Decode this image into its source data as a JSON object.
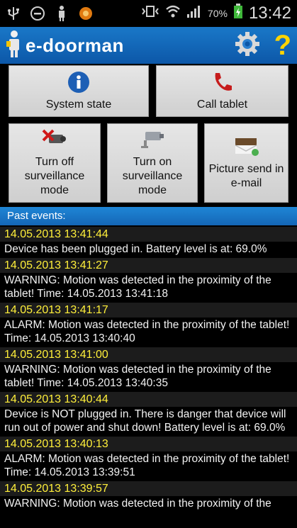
{
  "status_bar": {
    "battery_text": "70%",
    "time": "13:42",
    "icons": [
      "usb-icon",
      "do-not-disturb-icon",
      "doorman-icon",
      "app-badge-icon",
      "vibrate-icon",
      "wifi-icon",
      "signal-icon",
      "battery-icon"
    ]
  },
  "app": {
    "title": "e-doorman"
  },
  "buttons": {
    "system_state": "System state",
    "call_tablet": "Call tablet",
    "turn_off": "Turn off\nsurveillance\nmode",
    "turn_on": "Turn on\nsurveillance\nmode",
    "picture_send": "Picture send in\ne-mail"
  },
  "events_header": "Past events:",
  "events": [
    {
      "time": "14.05.2013 13:41:44",
      "text": "Device has been plugged in. Battery level is at: 69.0%"
    },
    {
      "time": "14.05.2013 13:41:27",
      "text": "WARNING: Motion was detected in the proximity of the tablet! Time: 14.05.2013 13:41:18"
    },
    {
      "time": "14.05.2013 13:41:17",
      "text": "ALARM: Motion was detected in the proximity of the tablet! Time: 14.05.2013 13:40:40"
    },
    {
      "time": "14.05.2013 13:41:00",
      "text": "WARNING: Motion was detected in the proximity of the tablet! Time: 14.05.2013 13:40:35"
    },
    {
      "time": "14.05.2013 13:40:44",
      "text": "Device is NOT plugged in. There is danger that device will run out of power and shut down! Battery level is at: 69.0%"
    },
    {
      "time": "14.05.2013 13:40:13",
      "text": "ALARM: Motion was detected in the proximity of the tablet! Time: 14.05.2013 13:39:51"
    },
    {
      "time": "14.05.2013 13:39:57",
      "text": "WARNING: Motion was detected in the proximity of the"
    }
  ],
  "colors": {
    "appbar": "#0c57a8",
    "event_time": "#ffef3a",
    "help": "#ffd400"
  }
}
